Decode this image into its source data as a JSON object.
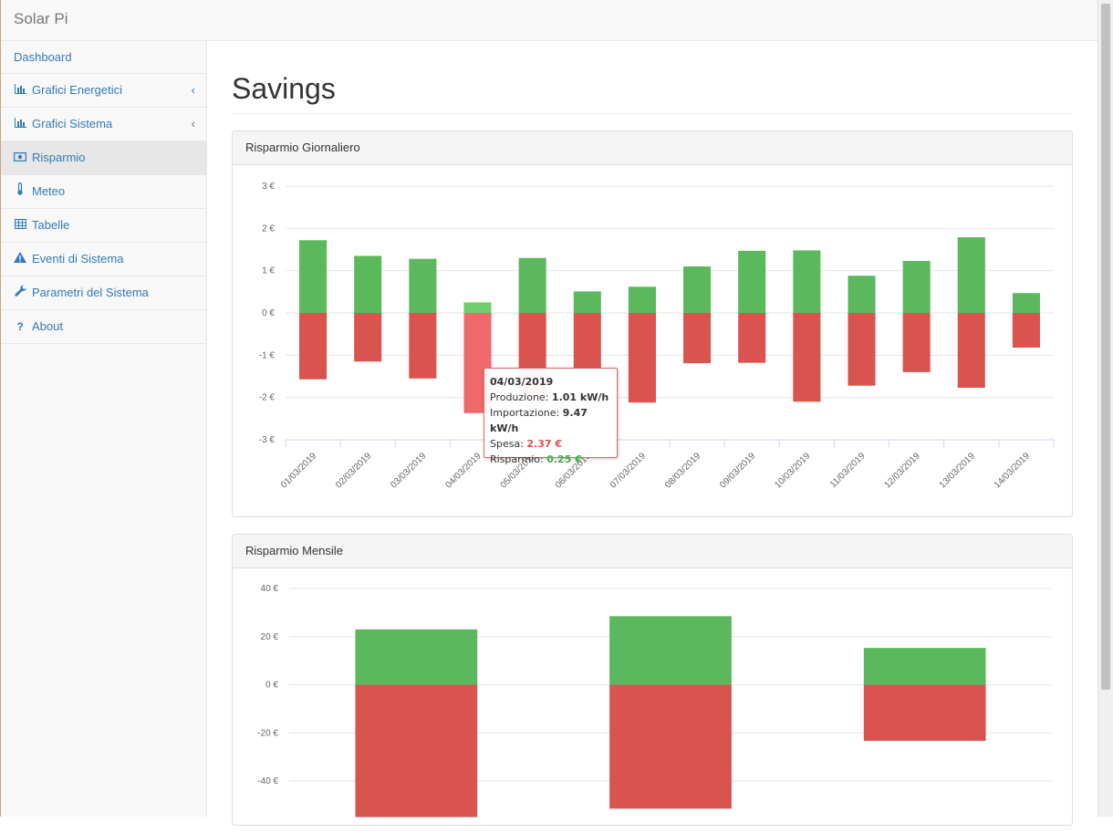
{
  "app": {
    "brand": "Solar Pi"
  },
  "sidebar": {
    "items": [
      {
        "label": "Dashboard",
        "icon": "",
        "chevron": false
      },
      {
        "label": "Grafici Energetici",
        "icon": "bar-chart-icon",
        "chevron": true
      },
      {
        "label": "Grafici Sistema",
        "icon": "bar-chart-icon",
        "chevron": true
      },
      {
        "label": "Risparmio",
        "icon": "money-icon",
        "chevron": false,
        "active": true
      },
      {
        "label": "Meteo",
        "icon": "thermometer-icon",
        "chevron": false
      },
      {
        "label": "Tabelle",
        "icon": "table-icon",
        "chevron": false
      },
      {
        "label": "Eventi di Sistema",
        "icon": "warning-icon",
        "chevron": false
      },
      {
        "label": "Parametri del Sistema",
        "icon": "wrench-icon",
        "chevron": false
      },
      {
        "label": "About",
        "icon": "question-icon",
        "chevron": false
      }
    ]
  },
  "page": {
    "title": "Savings"
  },
  "panels": {
    "daily": {
      "title": "Risparmio Giornaliero"
    },
    "monthly": {
      "title": "Risparmio Mensile"
    }
  },
  "tooltip": {
    "date": "04/03/2019",
    "produzione_label": "Produzione:",
    "produzione_value": "1.01 kW/h",
    "importazione_label": "Importazione:",
    "importazione_value": "9.47 kW/h",
    "spesa_label": "Spesa:",
    "spesa_value": "2.37 €",
    "risparmio_label": "Risparmio:",
    "risparmio_value": "0.25 €"
  },
  "colors": {
    "saving": "#5cb85c",
    "spending": "#d9534f",
    "saving_highlight": "#6fcf6f",
    "spending_highlight": "#f0696a",
    "link": "#337ab7"
  },
  "chart_data": [
    {
      "type": "bar",
      "title": "",
      "categories": [
        "01/03/2019",
        "02/03/2019",
        "03/03/2019",
        "04/03/2019",
        "05/03/2019",
        "06/03/2019",
        "07/03/2019",
        "08/03/2019",
        "09/03/2019",
        "10/03/2019",
        "11/03/2019",
        "12/03/2019",
        "13/03/2019",
        "14/03/2019"
      ],
      "series": [
        {
          "values": [
            1.72,
            1.35,
            1.28,
            0.25,
            1.3,
            0.51,
            0.62,
            1.1,
            1.47,
            1.48,
            0.88,
            1.23,
            1.79,
            0.47
          ]
        },
        {
          "values": [
            -1.57,
            -1.15,
            -1.55,
            -2.37,
            -1.98,
            -1.3,
            -2.12,
            -1.19,
            -1.18,
            -2.1,
            -1.72,
            -1.4,
            -1.77,
            -0.82
          ]
        }
      ],
      "stacked": true,
      "ylim": [
        -3,
        3
      ],
      "yticks": [
        3,
        2,
        1,
        0,
        -1,
        -2,
        -3
      ],
      "ytick_suffix": " €",
      "highlight_index": 3,
      "grid": true
    },
    {
      "type": "bar",
      "title": "",
      "categories": [
        "",
        "",
        ""
      ],
      "series": [
        {
          "values": [
            23.0,
            28.5,
            15.3
          ]
        },
        {
          "values": [
            -55.0,
            -51.5,
            -23.3
          ]
        }
      ],
      "stacked": true,
      "ylim": [
        -40,
        40
      ],
      "yticks": [
        40,
        20,
        0,
        -20,
        -40
      ],
      "ytick_suffix": " €",
      "grid": true
    }
  ]
}
